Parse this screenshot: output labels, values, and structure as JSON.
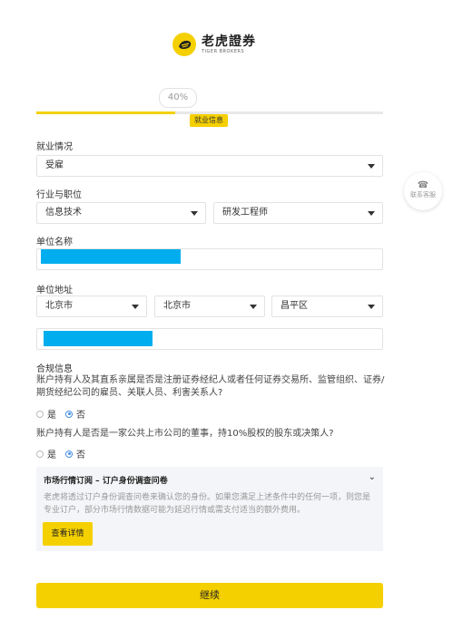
{
  "brand": {
    "name_cn": "老虎證券",
    "name_en": "TIGER BROKERS",
    "color": "#f5d000"
  },
  "progress": {
    "value": 40,
    "label": "40%",
    "step": "就业信息"
  },
  "employment": {
    "label": "就业情况",
    "value": "受雇"
  },
  "industry": {
    "label": "行业与职位",
    "industry_value": "信息技术",
    "position_value": "研发工程师"
  },
  "company_name": {
    "label": "单位名称"
  },
  "company_address": {
    "label": "单位地址",
    "province": "北京市",
    "city": "北京市",
    "district": "昌平区"
  },
  "compliance": {
    "title": "合规信息",
    "q1": "账户持有人及其直系亲属是否是注册证券经纪人或者任何证券交易所、监管组织、证券/期货经纪公司的雇员、关联人员、利害关系人?",
    "q2": "账户持有人是否是一家公共上市公司的董事，持10%股权的股东或决策人?",
    "yes": "是",
    "no": "否"
  },
  "market_panel": {
    "title": "市场行情订阅 – 订户身份调查问卷",
    "desc": "老虎将透过订户身份调查问卷来确认您的身份。如果您满足上述条件中的任何一项，则您是专业订户，部分市场行情数据可能为延迟行情或需支付适当的额外费用。",
    "button": "查看详情"
  },
  "continue": "继续",
  "support": {
    "label": "联系客服",
    "icon": "phone-icon"
  }
}
